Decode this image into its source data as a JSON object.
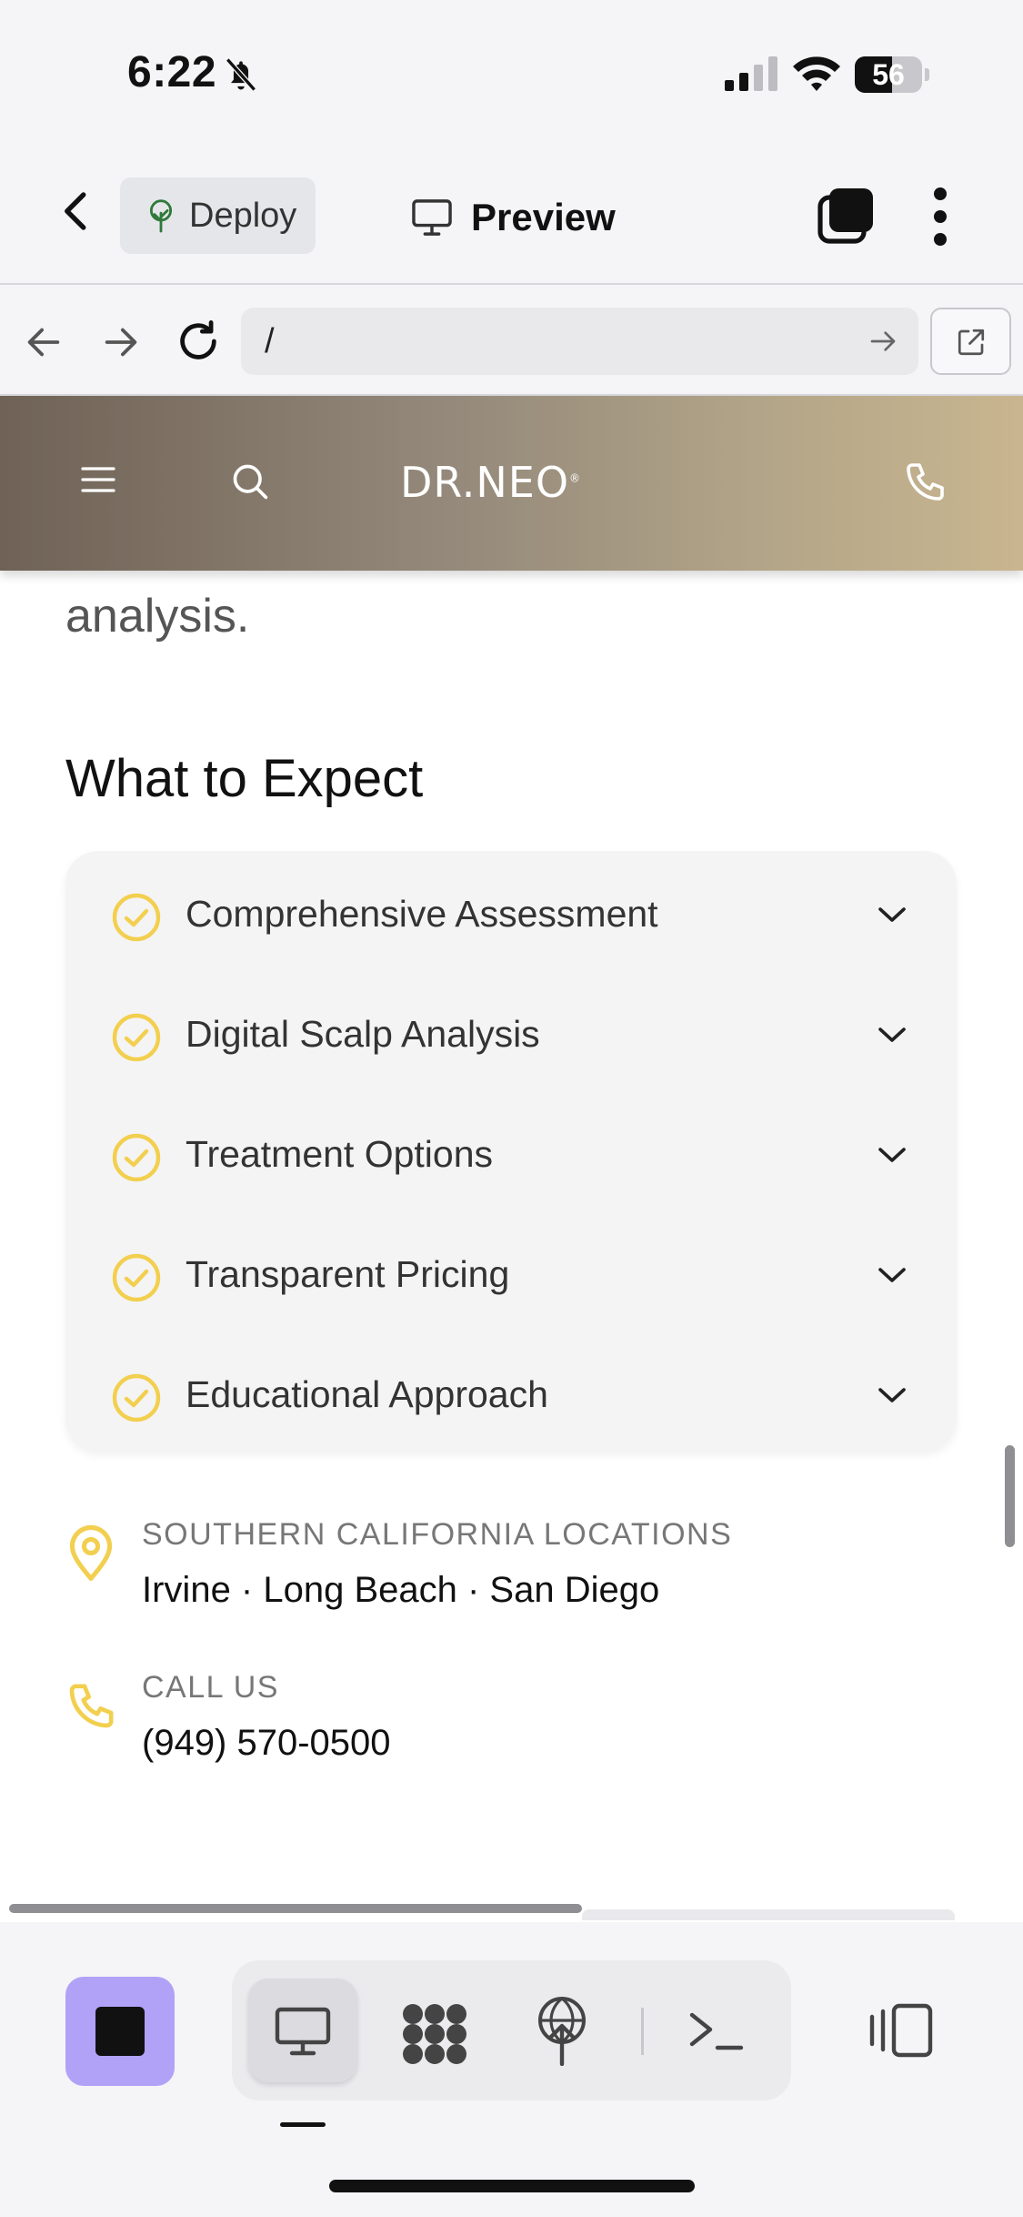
{
  "status_bar": {
    "time": "6:22",
    "battery_percent": "56",
    "battery_level": 0.56
  },
  "app_toolbar": {
    "deploy_label": "Deploy",
    "preview_label": "Preview"
  },
  "url_bar": {
    "url": "/"
  },
  "site_header": {
    "logo_text": "DR.NEO",
    "logo_mark": "®"
  },
  "content": {
    "lead_text": "analysis.",
    "section_title": "What to Expect",
    "accordion_items": [
      {
        "label": "Comprehensive Assessment"
      },
      {
        "label": "Digital Scalp Analysis"
      },
      {
        "label": "Treatment Options"
      },
      {
        "label": "Transparent Pricing"
      },
      {
        "label": "Educational Approach"
      }
    ],
    "locations": {
      "label": "SOUTHERN CALIFORNIA LOCATIONS",
      "value": "Irvine · Long Beach · San Diego"
    },
    "call": {
      "label": "CALL US",
      "value": "(949) 570-0500"
    }
  },
  "colors": {
    "accent_yellow": "#f2cf4e",
    "header_gradient_start": "#6f6256",
    "header_gradient_end": "#c9b690",
    "stop_button": "#b1a2f7"
  },
  "icons": {
    "status": [
      "bell-slash-icon",
      "cellular-signal-icon",
      "wifi-icon",
      "battery-icon"
    ],
    "toolbar": [
      "chevron-left-icon",
      "deploy-tree-icon",
      "monitor-icon",
      "tabs-icon",
      "more-vertical-icon"
    ],
    "url_bar": [
      "arrow-left-icon",
      "arrow-right-icon",
      "reload-icon",
      "go-arrow-icon",
      "open-external-icon"
    ],
    "site": [
      "hamburger-icon",
      "search-icon",
      "phone-icon",
      "check-circle-icon",
      "chevron-down-icon",
      "map-pin-icon"
    ],
    "bottom": [
      "stop-icon",
      "desktop-icon",
      "grid-dots-icon",
      "deploy-icon",
      "terminal-icon",
      "panel-toggle-icon"
    ]
  }
}
